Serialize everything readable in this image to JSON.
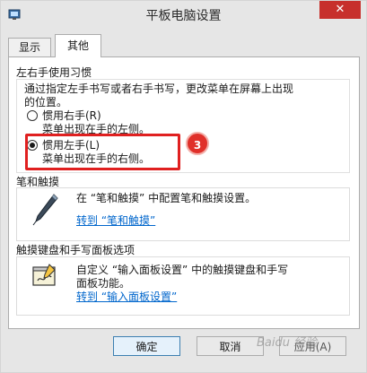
{
  "window": {
    "title": "平板电脑设置",
    "close_glyph": "✕"
  },
  "tabs": [
    {
      "label": "显示"
    },
    {
      "label": "其他"
    }
  ],
  "handedness": {
    "group_title": "左右手使用习惯",
    "description_line1": "通过指定左手书写或者右手书写，更改菜单在屏幕上出现",
    "description_line2": "的位置。",
    "right_label": "惯用右手(R)",
    "right_desc": "菜单出现在手的左侧。",
    "left_label": "惯用左手(L)",
    "left_desc": "菜单出现在手的右侧。",
    "selected": "left"
  },
  "annotation": {
    "step": "3",
    "color": "#e02020"
  },
  "pen_touch": {
    "group_title": "笔和触摸",
    "description": "在 “笔和触摸” 中配置笔和触摸设置。",
    "link": "转到 “笔和触摸”"
  },
  "input_panel": {
    "group_title": "触摸键盘和手写面板选项",
    "description_line1": "自定义 “输入面板设置” 中的触摸键盘和手写",
    "description_line2": "面板功能。",
    "link": "转到 “输入面板设置”"
  },
  "footer": {
    "ok": "确定",
    "cancel": "取消",
    "apply": "应用(A)"
  },
  "watermark": "Baidu 经验"
}
